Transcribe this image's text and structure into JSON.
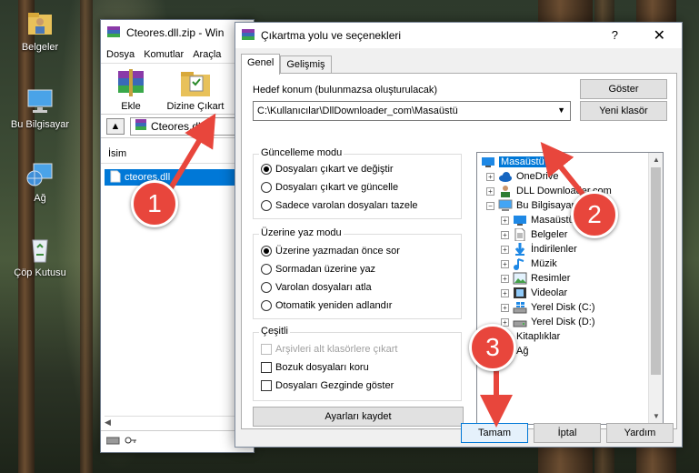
{
  "desktop": {
    "icons": [
      {
        "label": "Belgeler"
      },
      {
        "label": "Bu Bilgisayar"
      },
      {
        "label": "Ağ"
      },
      {
        "label": "Çöp Kutusu"
      }
    ]
  },
  "winrar": {
    "title": "Cteores.dll.zip - Win",
    "menu": [
      "Dosya",
      "Komutlar",
      "Araçla"
    ],
    "tools": [
      {
        "label": "Ekle"
      },
      {
        "label": "Dizine Çıkart"
      }
    ],
    "path": "Cteores.dll.",
    "column_header": "İsim",
    "file": "cteores.dll"
  },
  "dialog": {
    "title": "Çıkartma yolu ve seçenekleri",
    "help": "?",
    "close": "✕",
    "tabs": [
      "Genel",
      "Gelişmiş"
    ],
    "target_label": "Hedef konum (bulunmazsa oluşturulacak)",
    "target_value": "C:\\Kullanıcılar\\DllDownloader_com\\Masaüstü",
    "show_button": "Göster",
    "new_folder_button": "Yeni klasör",
    "update_mode": {
      "title": "Güncelleme modu",
      "options": [
        "Dosyaları çıkart ve değiştir",
        "Dosyaları çıkart ve güncelle",
        "Sadece varolan dosyaları tazele"
      ]
    },
    "overwrite_mode": {
      "title": "Üzerine yaz modu",
      "options": [
        "Üzerine yazmadan önce sor",
        "Sormadan üzerine yaz",
        "Varolan dosyaları atla",
        "Otomatik yeniden adlandır"
      ]
    },
    "misc": {
      "title": "Çeşitli",
      "options": [
        "Arşivleri alt klasörlere çıkart",
        "Bozuk dosyaları koru",
        "Dosyaları Gezginde göster"
      ]
    },
    "save_button": "Ayarları kaydet",
    "tree": [
      {
        "label": "Masaüstü"
      },
      {
        "label": "OneDrive"
      },
      {
        "label": "DLL Downloader.com"
      },
      {
        "label": "Bu Bilgisayar"
      },
      {
        "label": "Masaüstü"
      },
      {
        "label": "Belgeler"
      },
      {
        "label": "İndirilenler"
      },
      {
        "label": "Müzik"
      },
      {
        "label": "Resimler"
      },
      {
        "label": "Videolar"
      },
      {
        "label": "Yerel Disk (C:)"
      },
      {
        "label": "Yerel Disk (D:)"
      },
      {
        "label": "Kitaplıklar"
      },
      {
        "label": "Ağ"
      }
    ],
    "ok_button": "Tamam",
    "cancel_button": "İptal",
    "help_button": "Yardım"
  },
  "annotations": [
    "1",
    "2",
    "3"
  ],
  "colors": {
    "accent": "#0078d7",
    "badge": "#e8463c"
  }
}
